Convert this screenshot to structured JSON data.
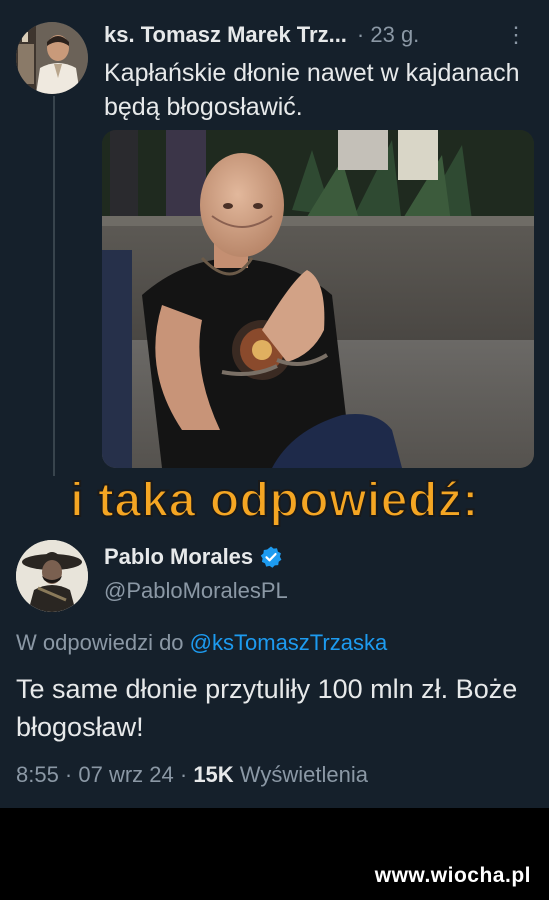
{
  "tweet": {
    "author_name": "ks. Tomasz Marek Trz...",
    "time": "· 23 g.",
    "more_icon": "more-vertical-icon",
    "text": "Kapłańskie dłonie nawet w kajdanach będą błogosławić."
  },
  "caption": "i taka odpowiedź:",
  "reply": {
    "author_name": "Pablo Morales",
    "verified_icon": "verified-badge-icon",
    "handle": "@PabloMoralesPL",
    "replying_to_label": "W odpowiedzi do",
    "replying_to_mention": "@ksTomaszTrzaska",
    "text": "Te same dłonie przytuliły 100 mln zł. Boże błogosław!",
    "time": "8:55 · 07 wrz 24 ·",
    "views_count": "15K",
    "views_label": "Wyświetlenia"
  },
  "watermark": "www.wiocha.pl",
  "colors": {
    "background": "#15202b",
    "text": "#e7e9ea",
    "secondary": "#8b98a5",
    "accent": "#1d9bf0",
    "caption": "#f5a623"
  }
}
